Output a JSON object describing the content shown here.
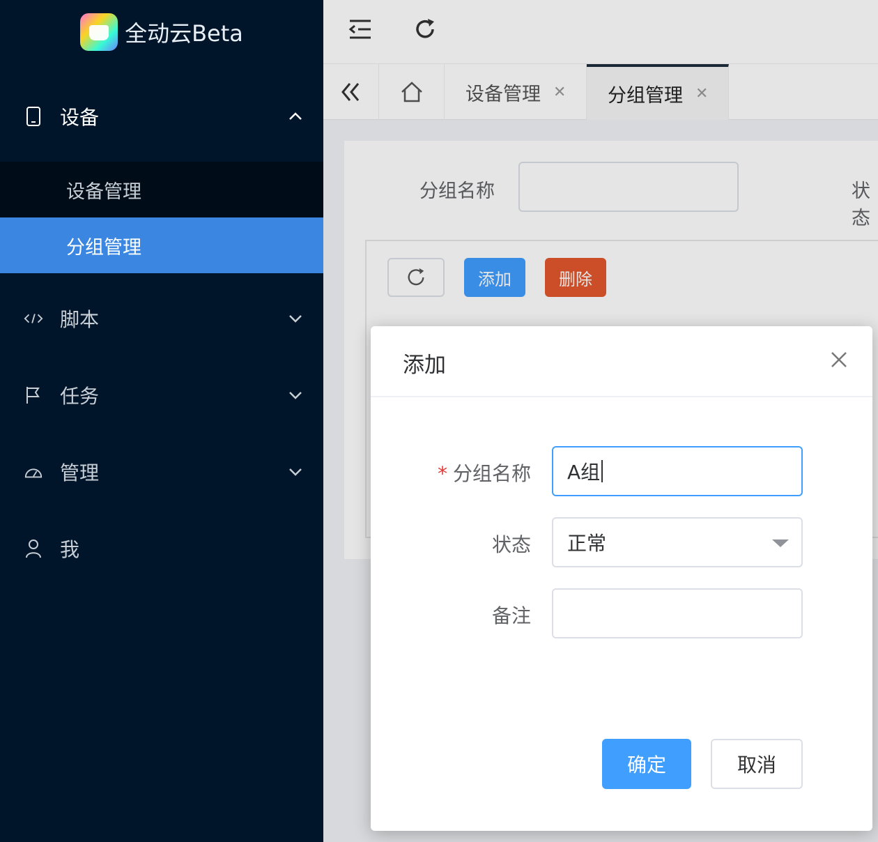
{
  "brand": {
    "name": "全动云Beta"
  },
  "sidebar": {
    "groups": [
      {
        "label": "设备",
        "icon": "mobile-icon",
        "expanded": true
      },
      {
        "label": "脚本",
        "icon": "code-icon",
        "expanded": false
      },
      {
        "label": "任务",
        "icon": "flag-icon",
        "expanded": false
      },
      {
        "label": "管理",
        "icon": "dashboard-icon",
        "expanded": false
      },
      {
        "label": "我",
        "icon": "user-icon"
      }
    ],
    "device_submenu": [
      {
        "label": "设备管理",
        "active": false
      },
      {
        "label": "分组管理",
        "active": true
      }
    ]
  },
  "tabs": [
    {
      "label": "设备管理",
      "active": false
    },
    {
      "label": "分组管理",
      "active": true
    }
  ],
  "filter": {
    "group_name_label": "分组名称",
    "status_label_partial": "状态"
  },
  "toolbar": {
    "add_label": "添加",
    "delete_label": "删除"
  },
  "modal": {
    "title": "添加",
    "fields": {
      "group_name": {
        "label": "分组名称",
        "required_mark": "*",
        "value": "A组"
      },
      "status": {
        "label": "状态",
        "value": "正常"
      },
      "remark": {
        "label": "备注",
        "value": ""
      }
    },
    "confirm_label": "确定",
    "cancel_label": "取消"
  },
  "colors": {
    "sidebar_bg": "#001529",
    "active_menu": "#3a86e0",
    "primary": "#409eff",
    "danger": "#e4572e"
  }
}
